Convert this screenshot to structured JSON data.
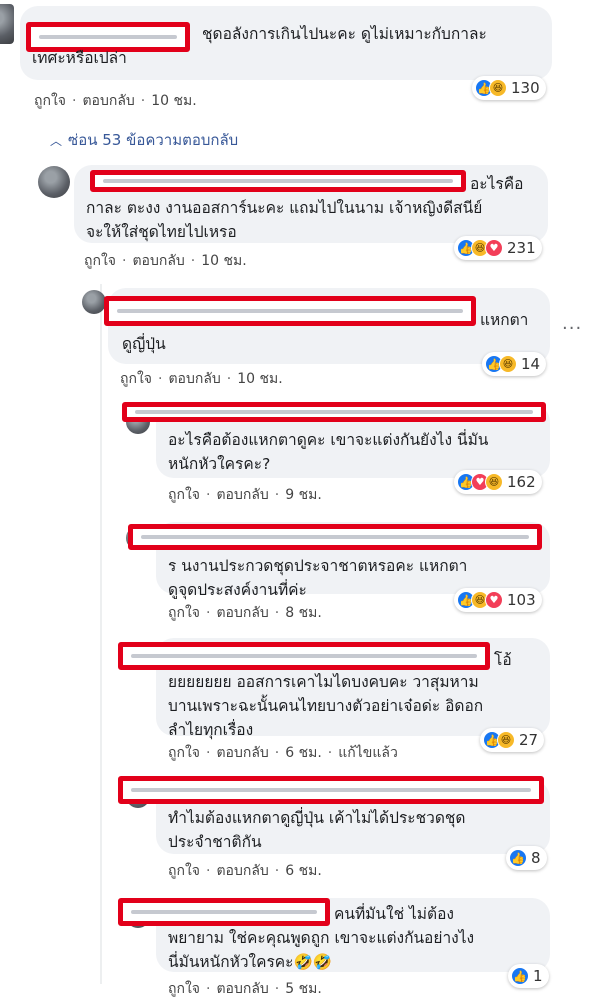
{
  "comment1": {
    "text": "ชุดอลังการเกินไปนะคะ ดูไม่เหมาะกับกาละ\nเทศะหรือเปล่า",
    "actions": {
      "like": "ถูกใจ",
      "reply": "ตอบกลับ",
      "time": "10 ชม."
    },
    "reaction_count": "130"
  },
  "hide_replies": {
    "icon": "chevron-up",
    "label": "ซ่อน 53 ข้อความตอบกลับ"
  },
  "reply1": {
    "text_first": "อะไรคือ",
    "text_rest": "กาละ ตะงง งานออสการ์นะคะ แถมไปในนาม เจ้าหญิงดีสนีย์\nจะให้ใส่ชุดไทยไปเหรอ",
    "actions": {
      "like": "ถูกใจ",
      "reply": "ตอบกลับ",
      "time": "10 ชม."
    },
    "reaction_count": "231"
  },
  "reply2": {
    "text_first": "แหกตา",
    "text_rest": "ดูญี่ปุ่น",
    "actions": {
      "like": "ถูกใจ",
      "reply": "ตอบกลับ",
      "time": "10 ชม."
    },
    "reaction_count": "14"
  },
  "reply3": {
    "text": "อะไรคือต้องแหกตาดูคะ เขาจะแต่งกันยังไง นี่มัน\nหนักหัวใครคะ?",
    "actions": {
      "like": "ถูกใจ",
      "reply": "ตอบกลับ",
      "time": "9 ชม."
    },
    "reaction_count": "162"
  },
  "reply4": {
    "text": "ร นงานประกวดชุดประจาชาตหรอคะ แหกตา\nดูจุดประสงค์งานที่ค่ะ",
    "actions": {
      "like": "ถูกใจ",
      "reply": "ตอบกลับ",
      "time": "8 ชม."
    },
    "reaction_count": "103"
  },
  "reply5": {
    "text_first": "โอ้",
    "text_rest": "ยยยยยยย ออสการเคาไมไดบงคบคะ วาสุมหาม\nบานเพราะฉะนั้นคนไทยบางตัวอย่าเจ๋อด่ะ อิดอก\nลำไยทุกเรื่อง",
    "actions": {
      "like": "ถูกใจ",
      "reply": "ตอบกลับ",
      "time": "6 ชม.",
      "edited": "แก้ไขแล้ว"
    },
    "reaction_count": "27"
  },
  "reply6": {
    "text": "ทำไมต้องแหกตาดูญี่ปุ่น เค้าไม่ได้ประชวดชุด\nประจำชาติกัน",
    "actions": {
      "like": "ถูกใจ",
      "reply": "ตอบกลับ",
      "time": "6 ชม."
    },
    "reaction_count": "8"
  },
  "reply7": {
    "text_first": "คนที่มันใช่ ไม่ต้อง",
    "text_rest": "พยายาม ใช่คะคุณพูดถูก เขาจะแต่งกันอย่างไง\nนี่มันหนักหัวใครคะ🤣🤣",
    "actions": {
      "like": "ถูกใจ",
      "reply": "ตอบกลับ",
      "time": "5 ชม."
    },
    "reaction_count": "1"
  },
  "more_options": "···"
}
